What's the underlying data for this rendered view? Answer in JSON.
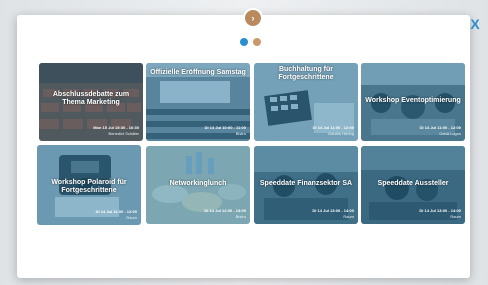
{
  "modal": {
    "close_label": "X",
    "pager_dots": 2
  },
  "cards": [
    {
      "title": "Abschlussdebatte zum Thema Marketing",
      "date": "Mon 15 Jul 15:30 - 16:30",
      "location": "Benedict Schäfer"
    },
    {
      "title": "Offizielle Eröffnung Samstag",
      "date": "Di 14 Jul 10:00 - 11:00",
      "location": "Bistro"
    },
    {
      "title": "Buchhaltung für Fortgeschrittene",
      "date": "Di 14 Jul 11:00 - 12:00",
      "location": "Gebäm Hering"
    },
    {
      "title": "Workshop Eventoptimierung",
      "date": "Di 14 Jul 11:00 - 12:00",
      "location": "Gebä Logos"
    },
    {
      "title": "Workshop Polaroid für Fortgeschrittene",
      "date": "Di 14 Jul 11:00 - 12:00",
      "location": "Raum"
    },
    {
      "title": "Networkinglunch",
      "date": "Di 14 Jul 12:00 - 13:00",
      "location": "Bistro"
    },
    {
      "title": "Speeddate Finanzsektor SA",
      "date": "Di 14 Jul 13:00 - 14:00",
      "location": "Raum"
    },
    {
      "title": "Speeddate Aussteller",
      "date": "Di 14 Jul 13:00 - 14:00",
      "location": "Raum"
    }
  ]
}
